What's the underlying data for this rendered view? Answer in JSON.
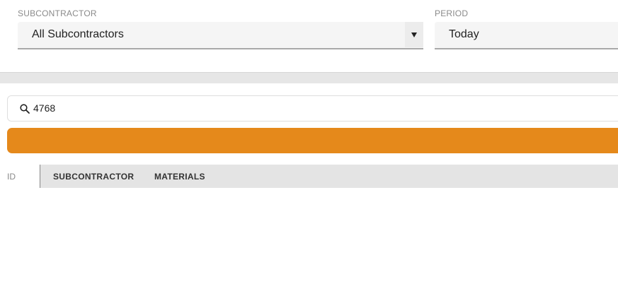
{
  "filters": {
    "subcontractor": {
      "label": "SUBCONTRACTOR",
      "value": "All Subcontractors"
    },
    "period": {
      "label": "PERIOD",
      "value": "Today"
    }
  },
  "search": {
    "value": "4768"
  },
  "table": {
    "columns": [
      "ID",
      "SUBCONTRACTOR",
      "MATERIALS"
    ]
  },
  "colors": {
    "accent": "#e5891b",
    "header_bg": "#e4e4e4",
    "input_bg": "#f5f5f5"
  },
  "icons": {
    "search": "search-icon",
    "dropdown": "chevron-down-icon"
  }
}
